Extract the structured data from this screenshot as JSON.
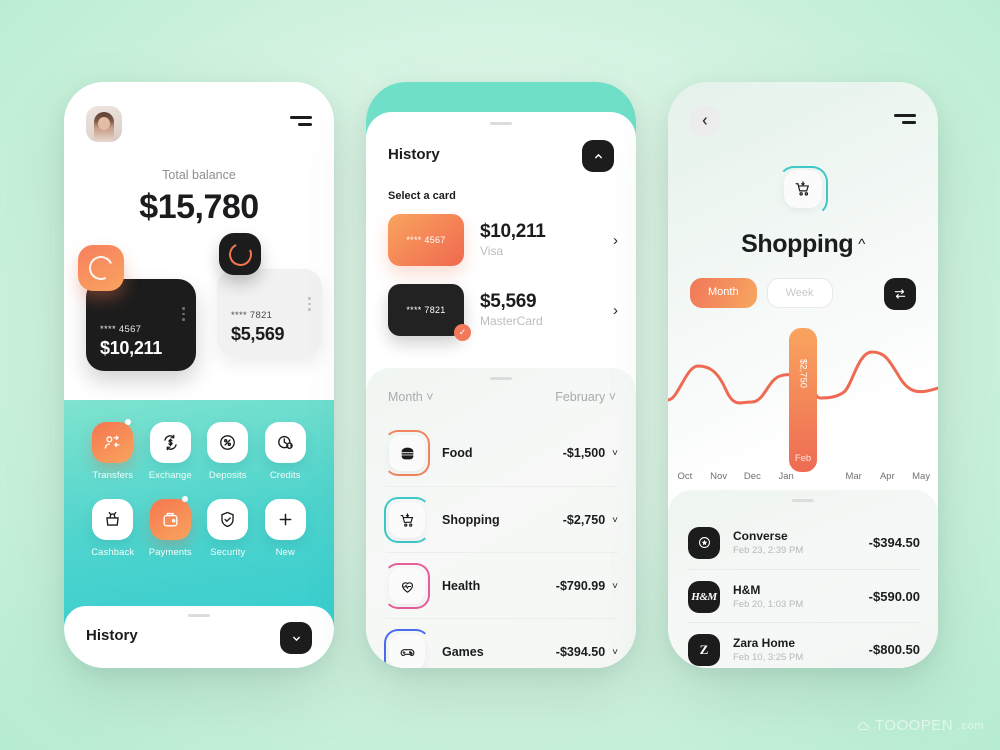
{
  "background": {
    "accent_teal": "#4fd4cd",
    "accent_orange": "#f4795a",
    "page_bg": "#c8f0da"
  },
  "watermark": {
    "brand": "TOOOPEN",
    "suffix": ".com",
    "icon": "cloud-icon"
  },
  "phone1": {
    "header": {
      "avatar": "user-avatar",
      "menu_icon": "hamburger-icon"
    },
    "balance_label": "Total balance",
    "balance_value": "$15,780",
    "cards": [
      {
        "number": "**** 4567",
        "amount": "$10,211",
        "theme": "dark"
      },
      {
        "number": "**** 7821",
        "amount": "$5,569",
        "theme": "light"
      }
    ],
    "menu_items": [
      {
        "label": "Transfers",
        "icon": "transfer-icon",
        "active": true,
        "notification": true
      },
      {
        "label": "Exchange",
        "icon": "exchange-icon",
        "active": false,
        "notification": false
      },
      {
        "label": "Deposits",
        "icon": "percent-icon",
        "active": false,
        "notification": false
      },
      {
        "label": "Credits",
        "icon": "credit-clock-icon",
        "active": false,
        "notification": false
      },
      {
        "label": "Cashback",
        "icon": "purse-icon",
        "active": false,
        "notification": false
      },
      {
        "label": "Payments",
        "icon": "wallet-icon",
        "active": true,
        "notification": true
      },
      {
        "label": "Security",
        "icon": "shield-check-icon",
        "active": false,
        "notification": false
      },
      {
        "label": "New",
        "icon": "plus-icon",
        "active": false,
        "notification": false
      }
    ],
    "sheet": {
      "title": "History",
      "button_icon": "chevron-down-icon"
    }
  },
  "phone2": {
    "title": "History",
    "collapse_icon": "chevron-up-icon",
    "select_card_label": "Select a card",
    "cards": [
      {
        "number": "**** 4567",
        "amount": "$10,211",
        "brand": "Visa",
        "theme": "orange",
        "selected": false
      },
      {
        "number": "**** 7821",
        "amount": "$5,569",
        "brand": "MasterCard",
        "theme": "dark",
        "selected": true
      }
    ],
    "filters": {
      "period": "Month",
      "month": "February"
    },
    "categories": [
      {
        "name": "Food",
        "amount": "-$1,500",
        "icon": "burger-icon",
        "arc_color": "#f0855f",
        "arc_side": "right"
      },
      {
        "name": "Shopping",
        "amount": "-$2,750",
        "icon": "cart-icon",
        "arc_color": "#3ec8c8",
        "arc_side": "left"
      },
      {
        "name": "Health",
        "amount": "-$790.99",
        "icon": "heart-pulse-icon",
        "arc_color": "#e85d9b",
        "arc_side": "right"
      },
      {
        "name": "Games",
        "amount": "-$394.50",
        "icon": "gamepad-icon",
        "arc_color": "#4a6df0",
        "arc_side": "left"
      }
    ]
  },
  "phone3": {
    "back_icon": "chevron-left-icon",
    "menu_icon": "hamburger-icon",
    "category_icon": "cart-icon",
    "title": "Shopping",
    "title_caret": "chevron-up-icon",
    "segments": [
      {
        "label": "Month",
        "active": true
      },
      {
        "label": "Week",
        "active": false
      }
    ],
    "swap_icon": "swap-icon",
    "transactions": [
      {
        "name": "Converse",
        "date": "Feb 23, 2:39 PM",
        "amount": "-$394.50",
        "icon": "converse-star-icon"
      },
      {
        "name": "H&M",
        "date": "Feb 20, 1:03 PM",
        "amount": "-$590.00",
        "icon": "hm-logo-icon"
      },
      {
        "name": "Zara Home",
        "date": "Feb 10, 3:25 PM",
        "amount": "-$800.50",
        "icon": "zara-z-icon"
      }
    ]
  },
  "chart_data": {
    "type": "line",
    "title": "Shopping",
    "categories": [
      "Oct",
      "Nov",
      "Dec",
      "Jan",
      "Feb",
      "Mar",
      "Apr",
      "May"
    ],
    "values": [
      1500,
      2250,
      1350,
      2050,
      2750,
      1450,
      2500,
      1750
    ],
    "highlight": {
      "category": "Feb",
      "label": "$2,750",
      "value": 2750
    },
    "xlabel": "",
    "ylabel": "",
    "ylim": [
      0,
      3000
    ],
    "grid": false,
    "legend": "none",
    "line_color": "#ef6a52"
  }
}
